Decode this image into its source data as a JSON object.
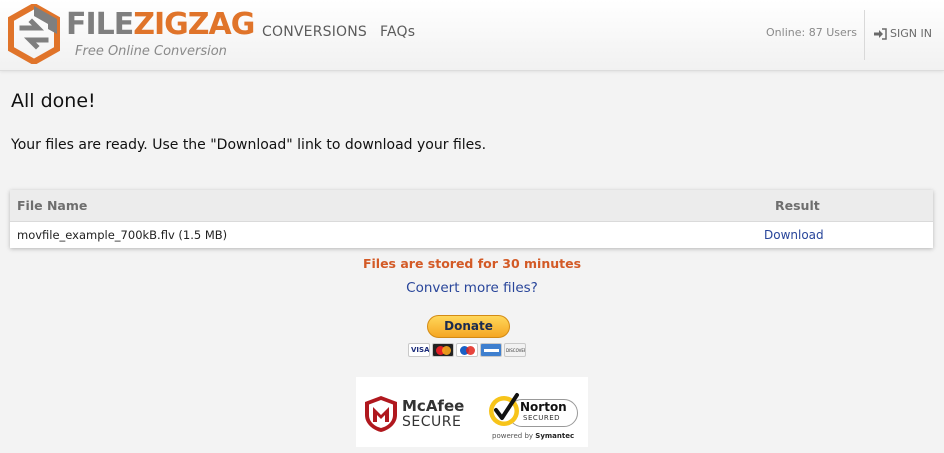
{
  "header": {
    "logo": {
      "text_primary": "FILE",
      "text_accent": "ZIGZAG",
      "tagline": "Free Online Conversion"
    },
    "nav": [
      {
        "label": "CONVERSIONS"
      },
      {
        "label": "FAQs"
      }
    ],
    "online_status": "Online: 87 Users",
    "sign_in_label": "SIGN IN"
  },
  "main": {
    "title": "All done!",
    "message": "Your files are ready. Use the \"Download\" link to download your files.",
    "table": {
      "columns": [
        "File Name",
        "Result"
      ],
      "rows": [
        {
          "file_name": "movfile_example_700kB.flv (1.5 MB)",
          "result": "Download"
        }
      ]
    },
    "storage_note": "Files are stored for 30 minutes",
    "convert_more_label": "Convert more files?"
  },
  "donate": {
    "button_label": "Donate",
    "cards": [
      "visa-icon",
      "mastercard-icon",
      "maestro-icon",
      "amex-icon",
      "discover-icon"
    ]
  },
  "seals": {
    "mcafee_name": "McAfee",
    "mcafee_secure": "SECURE",
    "norton_name": "Norton",
    "norton_secured": "SECURED",
    "norton_powered_prefix": "powered by",
    "norton_powered_brand": "Symantec"
  },
  "colors": {
    "brand_orange": "#e0742a",
    "brand_gray": "#7f7f7f",
    "link_blue": "#28459a",
    "note_orange": "#d35a26",
    "page_bg": "#f3f3f3"
  }
}
